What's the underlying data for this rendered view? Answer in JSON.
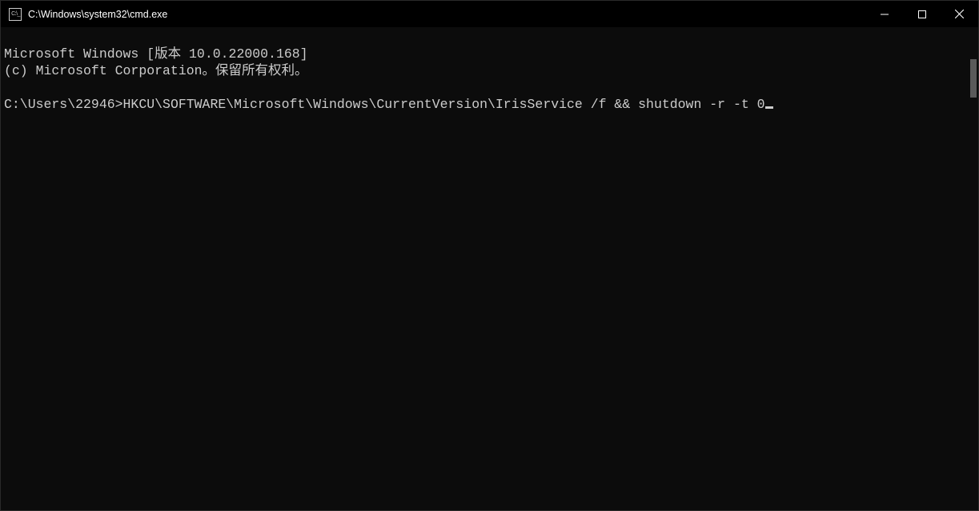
{
  "window": {
    "title": "C:\\Windows\\system32\\cmd.exe"
  },
  "terminal": {
    "line1": "Microsoft Windows [版本 10.0.22000.168]",
    "line2": "(c) Microsoft Corporation。保留所有权利。",
    "blank": "",
    "prompt": "C:\\Users\\22946>",
    "command": "HKCU\\SOFTWARE\\Microsoft\\Windows\\CurrentVersion\\IrisService /f && shutdown -r -t 0"
  },
  "icons": {
    "cmd_icon_text": "C:\\_"
  }
}
